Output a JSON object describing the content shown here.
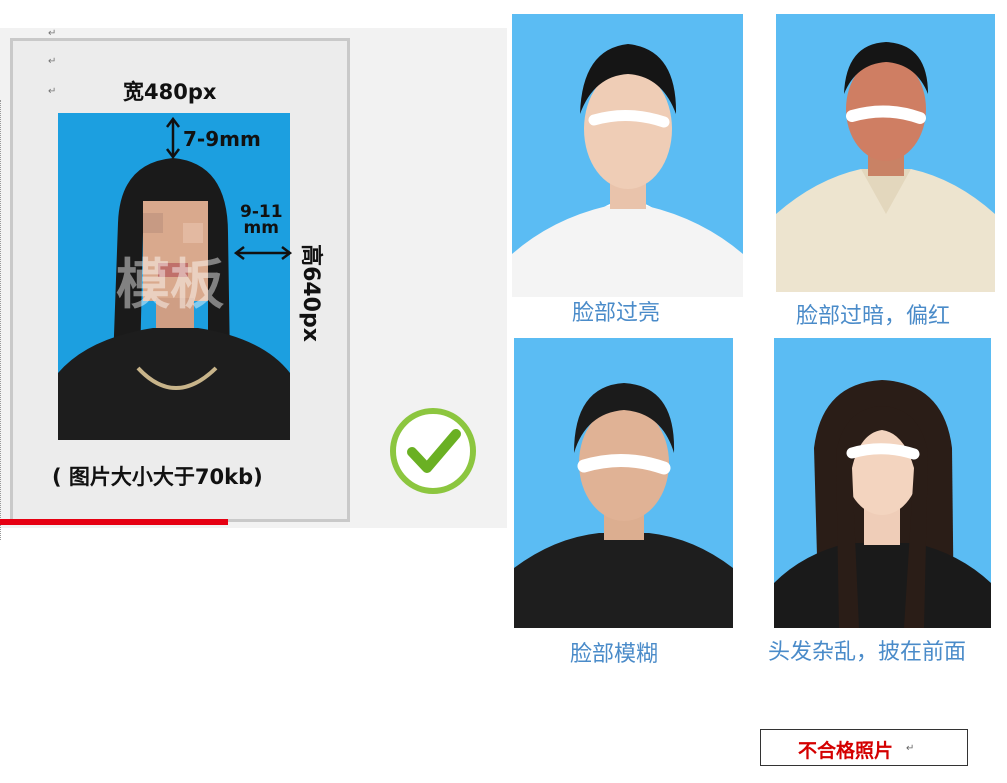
{
  "sample": {
    "paragraph_mark": "↵",
    "width_label": "宽480px",
    "height_label": "高640px",
    "margin_top_label": "7-9mm",
    "margin_side_line1": "9-11",
    "margin_side_line2": "mm",
    "size_note": "( 图片大小大于70kb)",
    "watermark": "模板"
  },
  "examples": [
    {
      "caption": "脸部过亮"
    },
    {
      "caption": "脸部过暗，偏红"
    },
    {
      "caption": "脸部模糊"
    },
    {
      "caption": "头发杂乱，披在前面"
    }
  ],
  "reject": {
    "label": "不合格照片",
    "mark": "↵"
  },
  "colors": {
    "accent_red": "#e60012",
    "caption_blue": "#4a8bc9",
    "photo_bg": "#5bbcf3",
    "check_green": "#8cc63f"
  }
}
